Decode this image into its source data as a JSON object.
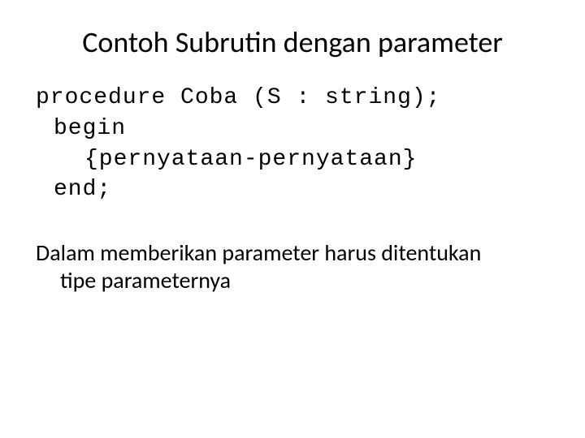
{
  "slide": {
    "title": "Contoh Subrutin dengan parameter",
    "code": {
      "line1": "procedure Coba (S : string);",
      "line2": "begin",
      "line3": "{pernyataan-pernyataan}",
      "line4": "end;"
    },
    "body": {
      "line1": "Dalam memberikan parameter harus ditentukan",
      "line2": "tipe parameternya"
    }
  }
}
